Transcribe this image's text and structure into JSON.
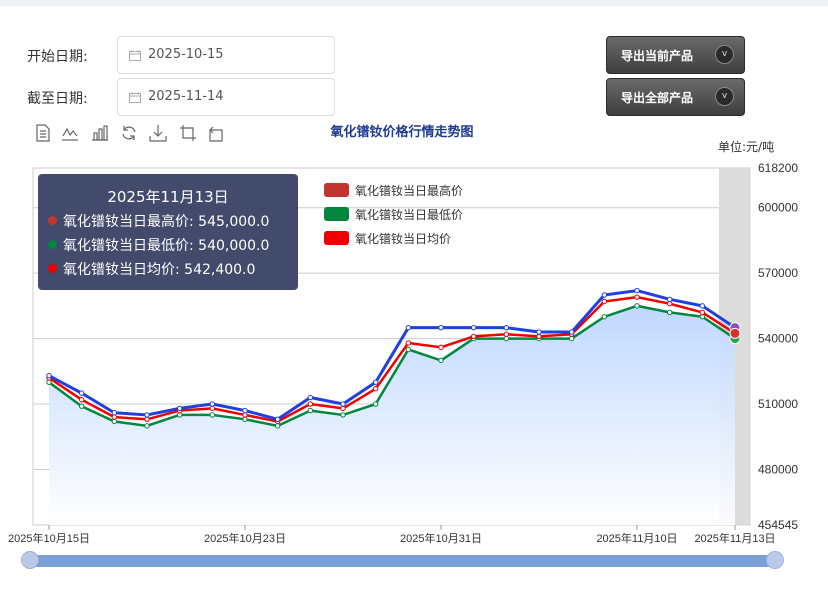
{
  "form": {
    "start_label": "开始日期:",
    "start_value": "2025-10-15",
    "end_label": "截至日期:",
    "end_value": "2025-11-14"
  },
  "buttons": {
    "export_current": "导出当前产品",
    "export_all": "导出全部产品",
    "chevron": "v"
  },
  "toolbox": [
    "document-icon",
    "line-chart-icon",
    "bar-chart-icon",
    "refresh-icon",
    "download-icon",
    "crop-icon",
    "restore-icon"
  ],
  "tooltip": {
    "title": "2025年11月13日",
    "rows": [
      {
        "text": "氧化镨钕当日最高价: 545,000.0",
        "color": "#c23531"
      },
      {
        "text": "氧化镨钕当日最低价: 540,000.0",
        "color": "#00873d"
      },
      {
        "text": "氧化镨钕当日均价: 542,400.0",
        "color": "#ee0000"
      }
    ]
  },
  "chart_data": {
    "type": "line",
    "title": "氧化镨钕价格行情走势图",
    "unit": "单位:元/吨",
    "x": [
      "2025-10-15",
      "2025-10-16",
      "2025-10-17",
      "2025-10-20",
      "2025-10-21",
      "2025-10-22",
      "2025-10-23",
      "2025-10-24",
      "2025-10-27",
      "2025-10-28",
      "2025-10-29",
      "2025-10-30",
      "2025-10-31",
      "2025-11-03",
      "2025-11-04",
      "2025-11-05",
      "2025-11-06",
      "2025-11-07",
      "2025-11-10",
      "2025-11-11",
      "2025-11-12",
      "2025-11-13"
    ],
    "x_tick_labels": [
      "2025年10月15日",
      "2025年10月23日",
      "2025年10月31日",
      "2025年11月10日",
      "2025年11月13日"
    ],
    "y_ticks": [
      454545,
      480000,
      510000,
      540000,
      570000,
      600000,
      618200
    ],
    "ylim": [
      454545,
      618200
    ],
    "legend": [
      "氧化镨钕当日最高价",
      "氧化镨钕当日最低价",
      "氧化镨钕当日均价"
    ],
    "legend_position": "top-left",
    "grid": true,
    "highlighted_date": "2025-11-13",
    "series": [
      {
        "name": "氧化镨钕当日最高价",
        "color": "#1f3fe0",
        "values": [
          523000,
          515000,
          506000,
          505000,
          508000,
          510000,
          507000,
          503000,
          513000,
          510000,
          520000,
          545000,
          545000,
          545000,
          545000,
          543000,
          543000,
          560000,
          562000,
          558000,
          555000,
          545000
        ]
      },
      {
        "name": "氧化镨钕当日最低价",
        "color": "#00873d",
        "values": [
          520000,
          509000,
          502000,
          500000,
          505000,
          505000,
          503000,
          500000,
          507000,
          505000,
          510000,
          535000,
          530000,
          540000,
          540000,
          540000,
          540000,
          550000,
          555000,
          552000,
          550000,
          540000
        ]
      },
      {
        "name": "氧化镨钕当日均价",
        "color": "#ee0000",
        "values": [
          522000,
          512000,
          504000,
          503000,
          507000,
          508000,
          505000,
          502000,
          510000,
          508000,
          517000,
          538000,
          536000,
          541000,
          542000,
          541000,
          542000,
          557000,
          559000,
          556000,
          552000,
          542400
        ]
      }
    ],
    "colors": {
      "high_line": "#1f3fe0",
      "low_line": "#00873d",
      "avg_line": "#ee0000",
      "area_top": "#bcd6ff",
      "highlight_band": "#dcdcdc"
    }
  },
  "zoom": {
    "start": 0,
    "end": 1
  }
}
